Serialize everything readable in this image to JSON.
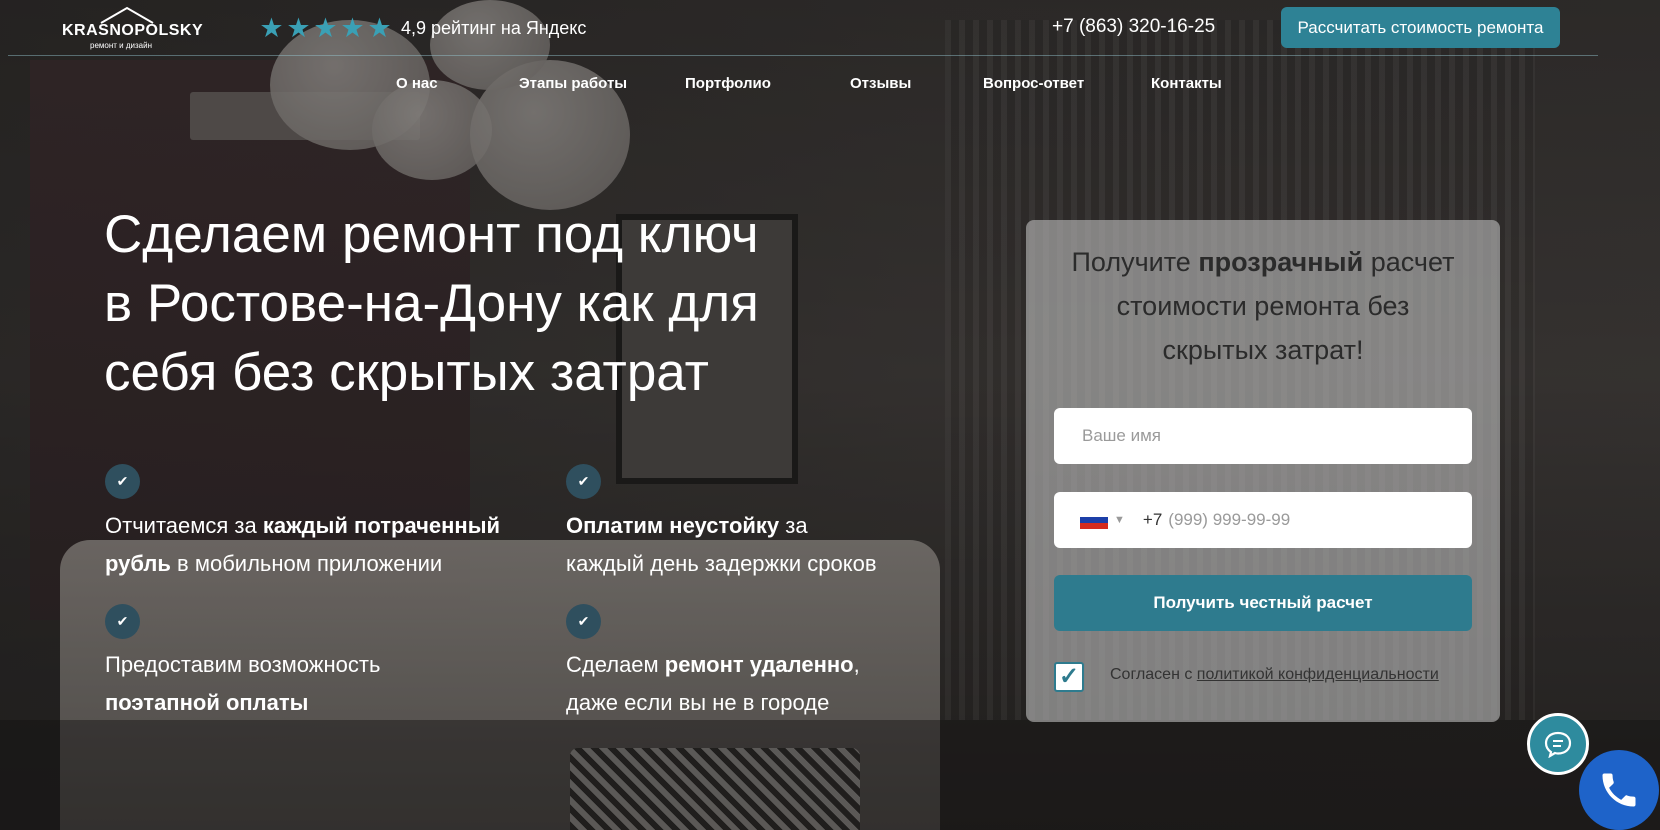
{
  "header": {
    "logo": {
      "name": "KRASNOPOLSKY",
      "subtitle": "ремонт и дизайн"
    },
    "rating": {
      "stars": 5,
      "text": "4,9 рейтинг на Яндекс"
    },
    "phone": "+7 (863) 320-16-25",
    "cta_label": "Рассчитать стоимость ремонта"
  },
  "nav": {
    "items": [
      "О нас",
      "Этапы работы",
      "Портфолио",
      "Отзывы",
      "Вопрос-ответ",
      "Контакты"
    ]
  },
  "hero": {
    "title_lines": [
      "Сделаем ремонт под ключ",
      "в Ростове-на-Дону как для",
      "себя без скрытых затрат"
    ],
    "features": [
      {
        "line1_pre": "Отчитаемся за ",
        "line1_bold": "каждый потраченный",
        "line2_bold": "рубль",
        "line2_post": " в мобильном приложении"
      },
      {
        "line1_bold": "Оплатим неустойку",
        "line1_post": " за",
        "line2": "каждый день задержки сроков"
      },
      {
        "line1": "Предоставим возможность",
        "line2_bold": "поэтапной оплаты"
      },
      {
        "line1_pre": "Сделаем ",
        "line1_bold": "ремонт удаленно",
        "line1_post": ",",
        "line2": "даже если вы не в городе"
      }
    ]
  },
  "form": {
    "title_pre": "Получите ",
    "title_bold": "прозрачный",
    "title_post_1": " расчет",
    "title_line2": "стоимости ремонта без",
    "title_line3": "скрытых затрат!",
    "name_placeholder": "Ваше имя",
    "phone_code": "+7",
    "phone_placeholder": "(999) 999-99-99",
    "submit_label": "Получить честный расчет",
    "agree_checked": true,
    "agree_text": "Согласен с ",
    "agree_link": "политикой конфиденциальности"
  },
  "colors": {
    "accent": "#2e8295",
    "star": "#3aa0b5",
    "check_bg": "#2f4f5e",
    "call_button": "#1e63c9"
  },
  "icons": {
    "chat": "chat-bubble-icon",
    "call": "phone-handset-icon",
    "check": "checkmark-icon",
    "flag": "russia-flag-icon"
  }
}
